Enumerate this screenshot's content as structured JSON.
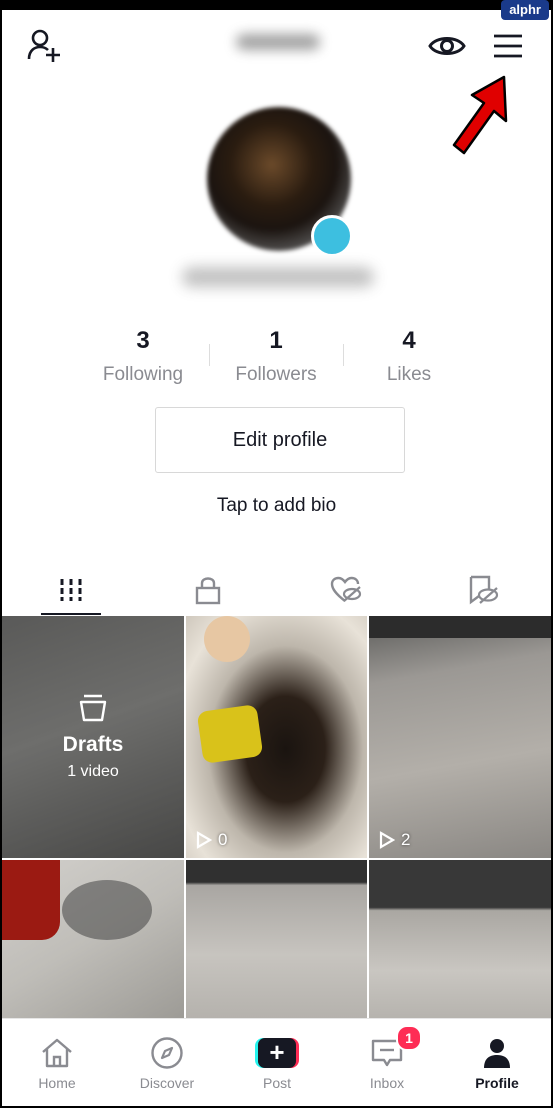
{
  "watermark": "alphr",
  "stats": [
    {
      "value": "3",
      "label": "Following"
    },
    {
      "value": "1",
      "label": "Followers"
    },
    {
      "value": "4",
      "label": "Likes"
    }
  ],
  "edit_profile_label": "Edit profile",
  "bio_placeholder": "Tap to add bio",
  "tabs": [
    {
      "icon": "grid-icon",
      "active": true
    },
    {
      "icon": "lock-icon",
      "active": false
    },
    {
      "icon": "hidden-liked-icon",
      "active": false
    },
    {
      "icon": "hidden-favorites-icon",
      "active": false
    }
  ],
  "drafts": {
    "title": "Drafts",
    "subtitle": "1 video"
  },
  "videos": [
    {
      "views": "0"
    },
    {
      "views": "2"
    }
  ],
  "nav": [
    {
      "label": "Home",
      "icon": "home-icon"
    },
    {
      "label": "Discover",
      "icon": "compass-icon"
    },
    {
      "label": "Post",
      "icon": "plus-icon"
    },
    {
      "label": "Inbox",
      "icon": "inbox-icon",
      "badge": "1"
    },
    {
      "label": "Profile",
      "icon": "person-icon",
      "active": true
    }
  ],
  "colors": {
    "accent": "#fe2c55",
    "cyan": "#25f4ee",
    "text": "#161823",
    "muted": "#8a8b91",
    "arrow": "#e00000"
  }
}
